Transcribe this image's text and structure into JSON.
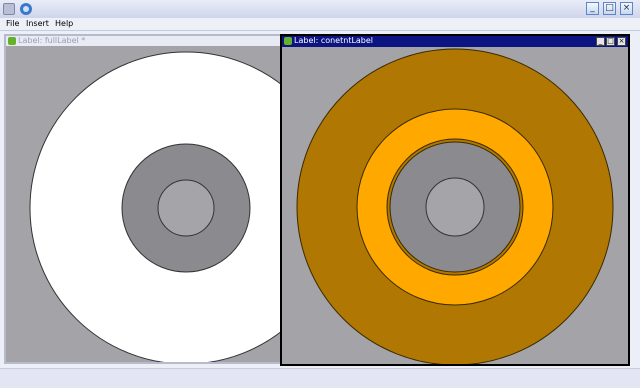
{
  "menubar": {
    "items": [
      "File",
      "Insert",
      "Help"
    ]
  },
  "titlebar": {
    "left_icons": [
      "tools-icon",
      "app-gear-icon"
    ],
    "buttons": {
      "minimize": "_",
      "maximize": "□",
      "close": "×"
    }
  },
  "left_window": {
    "title": "Label: fullLabel *"
  },
  "right_window": {
    "title": "Label: conetntLabel",
    "buttons": {
      "minimize": "_",
      "maximize": "□",
      "close": "×"
    }
  },
  "colors": {
    "canvas_bg": "#a3a3a8",
    "outer_white": "#ffffff",
    "ring_gray": "#8b8b8f",
    "center_light": "#a4a4a9",
    "outer_brown": "#b07803",
    "ring_orange": "#ffa800"
  }
}
